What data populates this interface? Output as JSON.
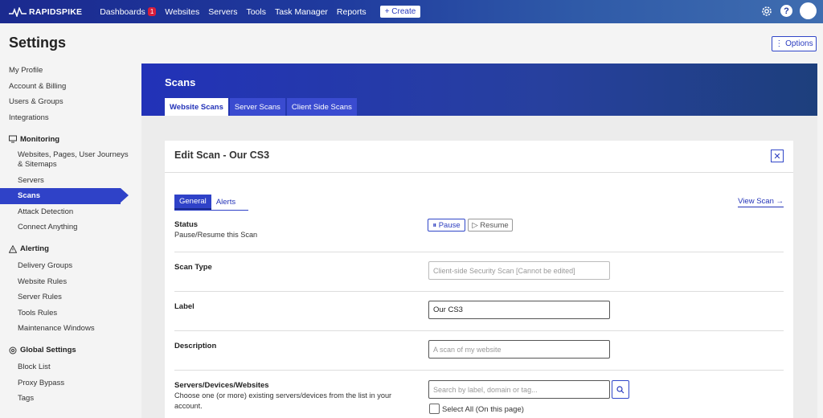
{
  "topbar": {
    "brand": "RAPIDSPIKE",
    "nav": [
      {
        "label": "Dashboards",
        "badge": "1"
      },
      {
        "label": "Websites"
      },
      {
        "label": "Servers"
      },
      {
        "label": "Tools"
      },
      {
        "label": "Task Manager"
      },
      {
        "label": "Reports"
      }
    ],
    "create_label": "+ Create",
    "help_label": "?"
  },
  "page": {
    "title": "Settings",
    "options_label": "⋮ Options"
  },
  "sidebar": {
    "top_items": [
      "My Profile",
      "Account & Billing",
      "Users & Groups",
      "Integrations"
    ],
    "monitoring": {
      "title": "Monitoring",
      "items": [
        "Websites, Pages, User Journeys & Sitemaps",
        "Servers",
        "Scans",
        "Attack Detection",
        "Connect Anything"
      ]
    },
    "alerting": {
      "title": "Alerting",
      "items": [
        "Delivery Groups",
        "Website Rules",
        "Server Rules",
        "Tools Rules",
        "Maintenance Windows"
      ]
    },
    "global": {
      "title": "Global Settings",
      "items": [
        "Block List",
        "Proxy Bypass",
        "Tags"
      ]
    }
  },
  "main": {
    "title": "Scans",
    "tabs": [
      "Website Scans",
      "Server Scans",
      "Client Side Scans"
    ]
  },
  "card": {
    "title": "Edit Scan - Our CS3",
    "close_label": "✕",
    "subtabs": [
      "General",
      "Alerts"
    ],
    "view_scan_label": "View Scan →",
    "status": {
      "label": "Status",
      "sub": "Pause/Resume this Scan",
      "pause_label": "⏸ Pause",
      "resume_label": "▷ Resume"
    },
    "scan_type": {
      "label": "Scan Type",
      "placeholder": "Client-side Security Scan [Cannot be edited]"
    },
    "label_field": {
      "label": "Label",
      "value": "Our CS3"
    },
    "description": {
      "label": "Description",
      "placeholder": "A scan of my website"
    },
    "servers": {
      "label": "Servers/Devices/Websites",
      "sub": "Choose one (or more) existing servers/devices from the list in your account.",
      "placeholder": "Search by label, domain or tag...",
      "select_all_label": "Select All (On this page)"
    }
  },
  "colors": {
    "accent": "#2f42c8",
    "badge": "#d81e3c",
    "header_dark": "#1b2a8f"
  }
}
